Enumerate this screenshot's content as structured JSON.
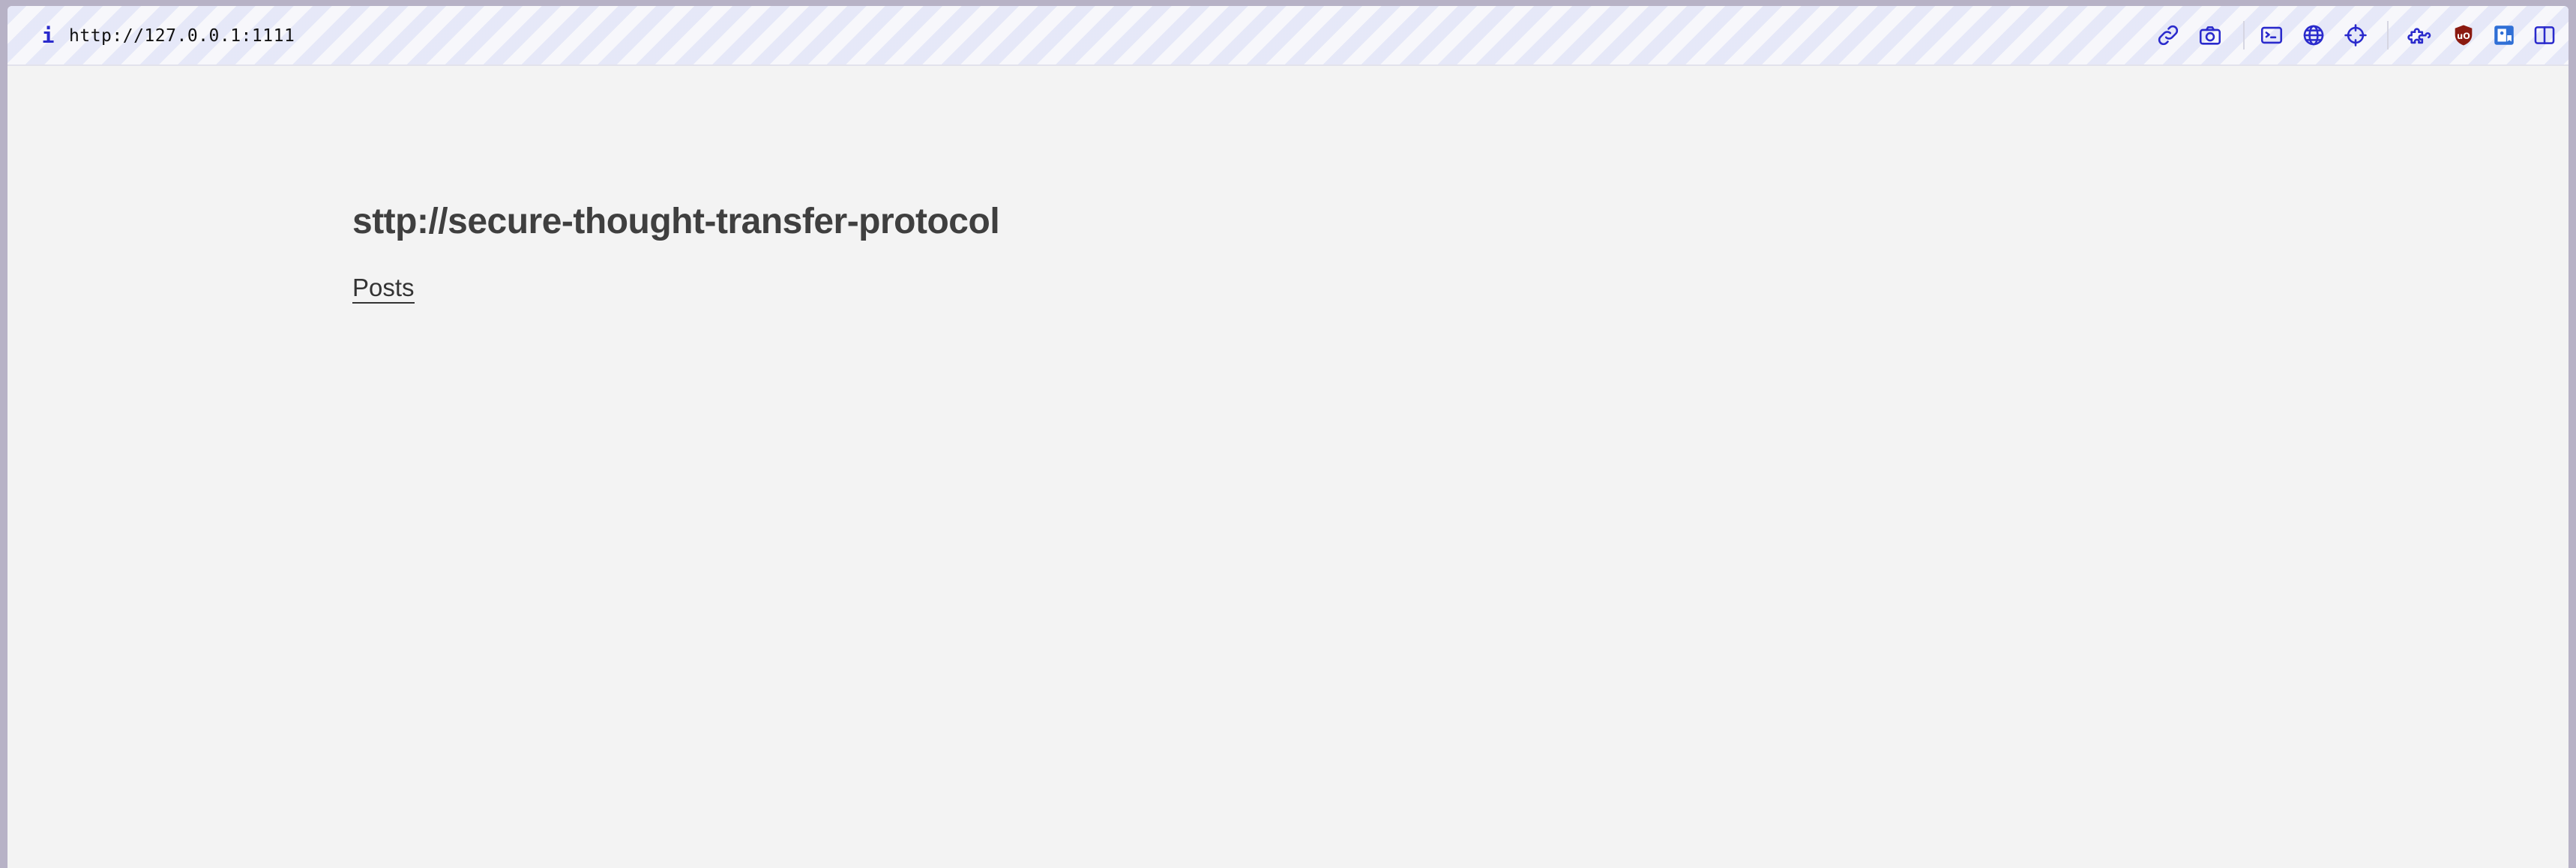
{
  "browser": {
    "url": "http://127.0.0.1:1111",
    "info_glyph": "i",
    "toolbar_icons": [
      "link-icon",
      "camera-icon",
      "terminal-icon",
      "globe-icon",
      "crosshair-icon",
      "extensions-icon",
      "ublock-icon",
      "bookmark-app-icon",
      "sidebar-icon"
    ],
    "accent_color": "#2a2acc",
    "ublock_color": "#8b1a10"
  },
  "page": {
    "site_title": "sttp://secure-thought-transfer-protocol",
    "nav": {
      "posts_label": "Posts"
    },
    "background": "#f3f3f3",
    "text_color": "#3f3f3f"
  }
}
